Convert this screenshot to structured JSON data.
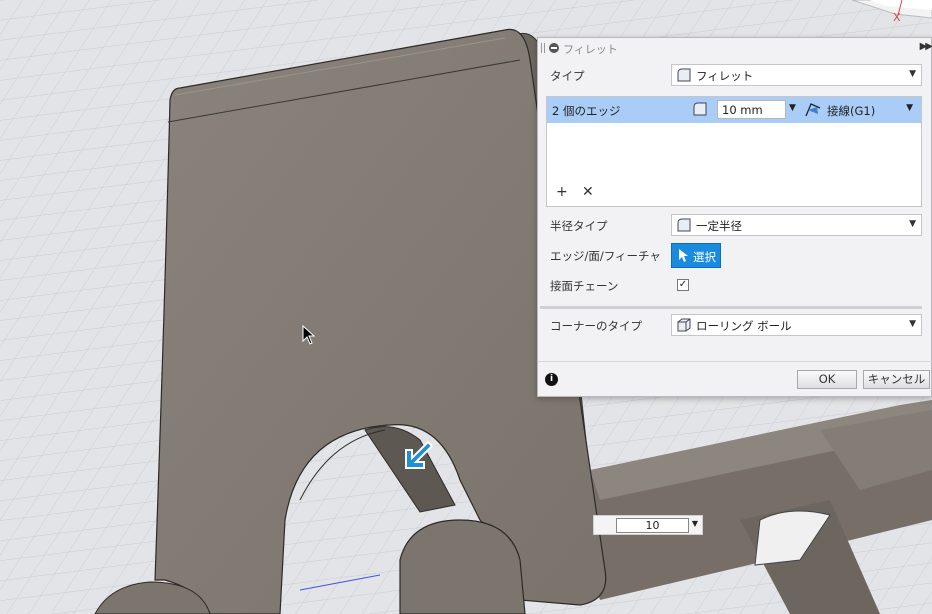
{
  "panel": {
    "title": "フィレット",
    "type_label": "タイプ",
    "type_value": "フィレット",
    "edges_count": "2 個のエッジ",
    "radius_value": "10 mm",
    "continuity_value": "接線(G1)",
    "radius_type_label": "半径タイプ",
    "radius_type_value": "一定半径",
    "edges_faces_label": "エッジ/面/フィーチャ",
    "select_button": "選択",
    "tangent_chain_label": "接面チェーン",
    "tangent_chain_checked": true,
    "corner_type_label": "コーナーのタイプ",
    "corner_type_value": "ローリング ボール",
    "ok_button": "OK",
    "cancel_button": "キャンセル"
  },
  "viewport": {
    "manipulator_input_value": "10",
    "axis_label": "X"
  },
  "colors": {
    "selection_row": "#a9cdf7",
    "select_button": "#1a8ce0",
    "model_surface": "#7d756d"
  }
}
